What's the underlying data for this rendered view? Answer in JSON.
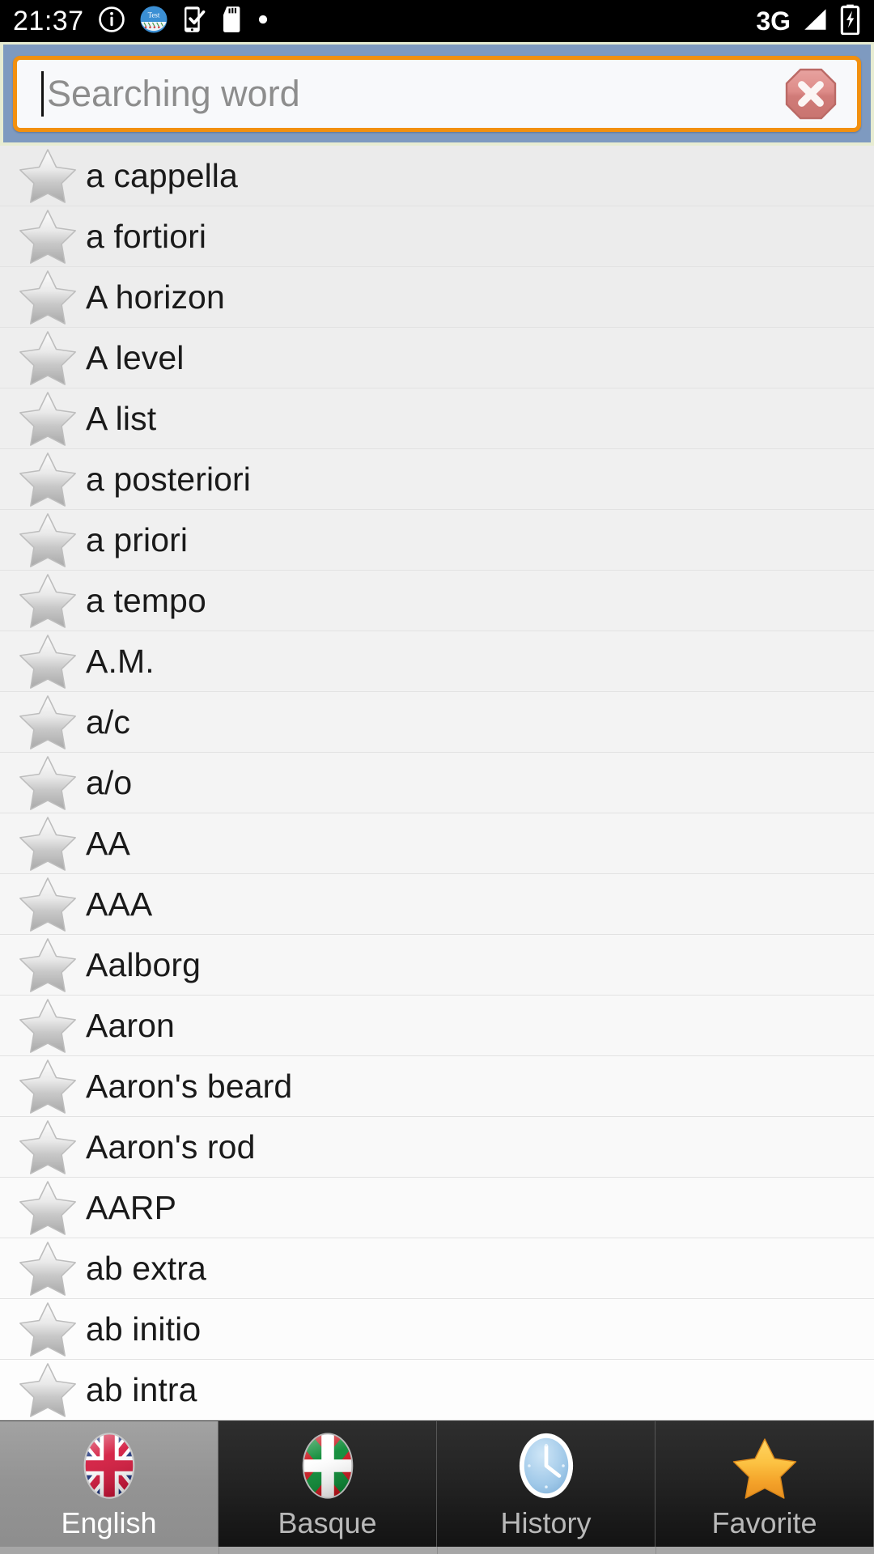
{
  "status_bar": {
    "time": "21:37",
    "network": "3G",
    "icons": [
      "info-icon",
      "test-app-icon",
      "phone-check-icon",
      "sd-card-icon",
      "dot-icon"
    ],
    "right_icons": [
      "signal-icon",
      "battery-charging-icon"
    ]
  },
  "search": {
    "placeholder": "Searching word",
    "value": "",
    "clear_label": "",
    "border_color": "#f2900f",
    "header_color": "#7e9ac0"
  },
  "list": {
    "items": [
      {
        "word": "a cappella",
        "favorite": false
      },
      {
        "word": "a fortiori",
        "favorite": false
      },
      {
        "word": "A horizon",
        "favorite": false
      },
      {
        "word": "A level",
        "favorite": false
      },
      {
        "word": "A list",
        "favorite": false
      },
      {
        "word": "a posteriori",
        "favorite": false
      },
      {
        "word": "a priori",
        "favorite": false
      },
      {
        "word": "a tempo",
        "favorite": false
      },
      {
        "word": "A.M.",
        "favorite": false
      },
      {
        "word": "a/c",
        "favorite": false
      },
      {
        "word": "a/o",
        "favorite": false
      },
      {
        "word": "AA",
        "favorite": false
      },
      {
        "word": "AAA",
        "favorite": false
      },
      {
        "word": "Aalborg",
        "favorite": false
      },
      {
        "word": "Aaron",
        "favorite": false
      },
      {
        "word": "Aaron's beard",
        "favorite": false
      },
      {
        "word": "Aaron's rod",
        "favorite": false
      },
      {
        "word": "AARP",
        "favorite": false
      },
      {
        "word": "ab extra",
        "favorite": false
      },
      {
        "word": "ab initio",
        "favorite": false
      },
      {
        "word": "ab intra",
        "favorite": false
      }
    ]
  },
  "tabs": [
    {
      "label": "English",
      "icon": "uk-flag-icon",
      "active": true
    },
    {
      "label": "Basque",
      "icon": "basque-flag-icon",
      "active": false
    },
    {
      "label": "History",
      "icon": "clock-icon",
      "active": false
    },
    {
      "label": "Favorite",
      "icon": "star-gold-icon",
      "active": false
    }
  ]
}
